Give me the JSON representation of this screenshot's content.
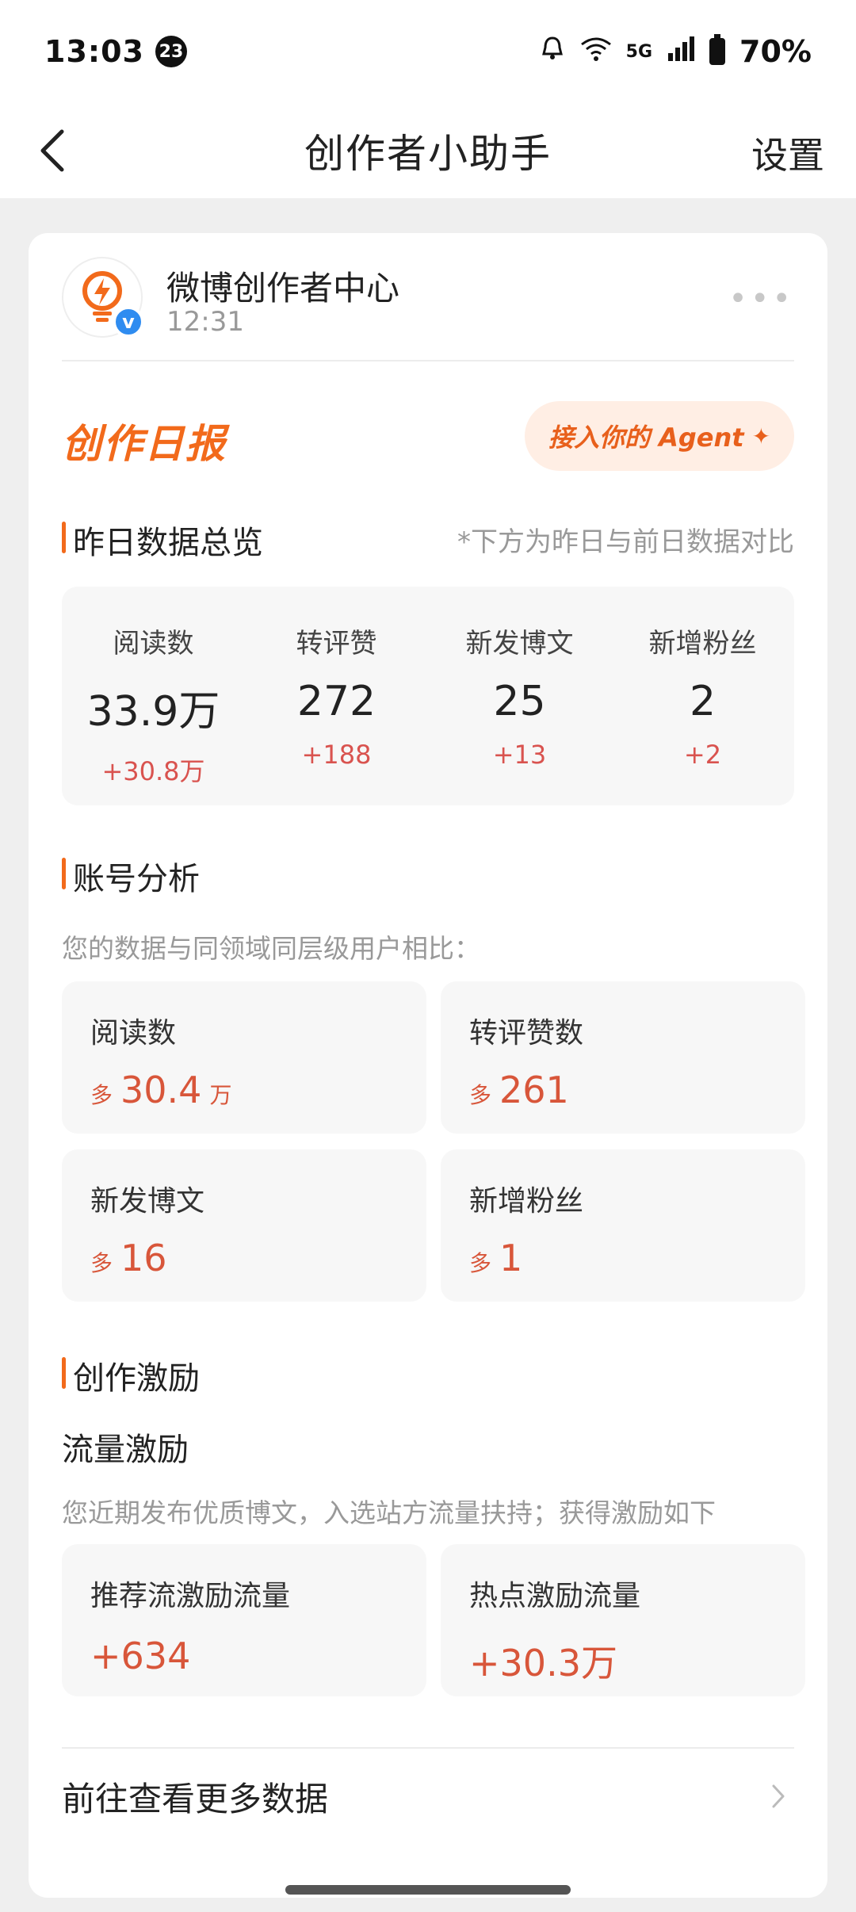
{
  "status_bar": {
    "time": "13:03",
    "notification_count": "23",
    "network": "5G",
    "battery": "70%"
  },
  "nav": {
    "title": "创作者小助手",
    "settings_label": "设置",
    "back_icon": "chevron-left-icon"
  },
  "message": {
    "account_name": "微博创作者中心",
    "time": "12:31",
    "avatar_icon": "lightbulb-icon",
    "verified_icon": "verified-icon",
    "more_icon": "more-icon"
  },
  "report": {
    "title": "创作日报",
    "agent_button": "接入你的 Agent",
    "agent_icon": "sparkle-icon"
  },
  "overview": {
    "title": "昨日数据总览",
    "note": "*下方为昨日与前日数据对比",
    "stats": [
      {
        "label": "阅读数",
        "value": "33.9万",
        "delta": "+30.8万"
      },
      {
        "label": "转评赞",
        "value": "272",
        "delta": "+188"
      },
      {
        "label": "新发博文",
        "value": "25",
        "delta": "+13"
      },
      {
        "label": "新增粉丝",
        "value": "2",
        "delta": "+2"
      }
    ]
  },
  "analysis": {
    "title": "账号分析",
    "subtitle": "您的数据与同领域同层级用户相比：",
    "tiles": [
      {
        "label": "阅读数",
        "prefix": "多",
        "value": "30.4",
        "unit": "万"
      },
      {
        "label": "转评赞数",
        "prefix": "多",
        "value": "261",
        "unit": ""
      },
      {
        "label": "新发博文",
        "prefix": "多",
        "value": "16",
        "unit": ""
      },
      {
        "label": "新增粉丝",
        "prefix": "多",
        "value": "1",
        "unit": ""
      }
    ]
  },
  "incentive": {
    "title": "创作激励",
    "subtitle": "流量激励",
    "description": "您近期发布优质博文，入选站方流量扶持；获得激励如下",
    "tiles": [
      {
        "label": "推荐流激励流量",
        "value": "+634"
      },
      {
        "label": "热点激励流量",
        "value": "+30.3万"
      }
    ]
  },
  "footer": {
    "more_label": "前往查看更多数据",
    "chevron_icon": "chevron-right-icon"
  },
  "colors": {
    "accent": "#f26a1b",
    "delta_red": "#d9534f",
    "value_red": "#d8563a",
    "verified_blue": "#2f8cf0"
  }
}
